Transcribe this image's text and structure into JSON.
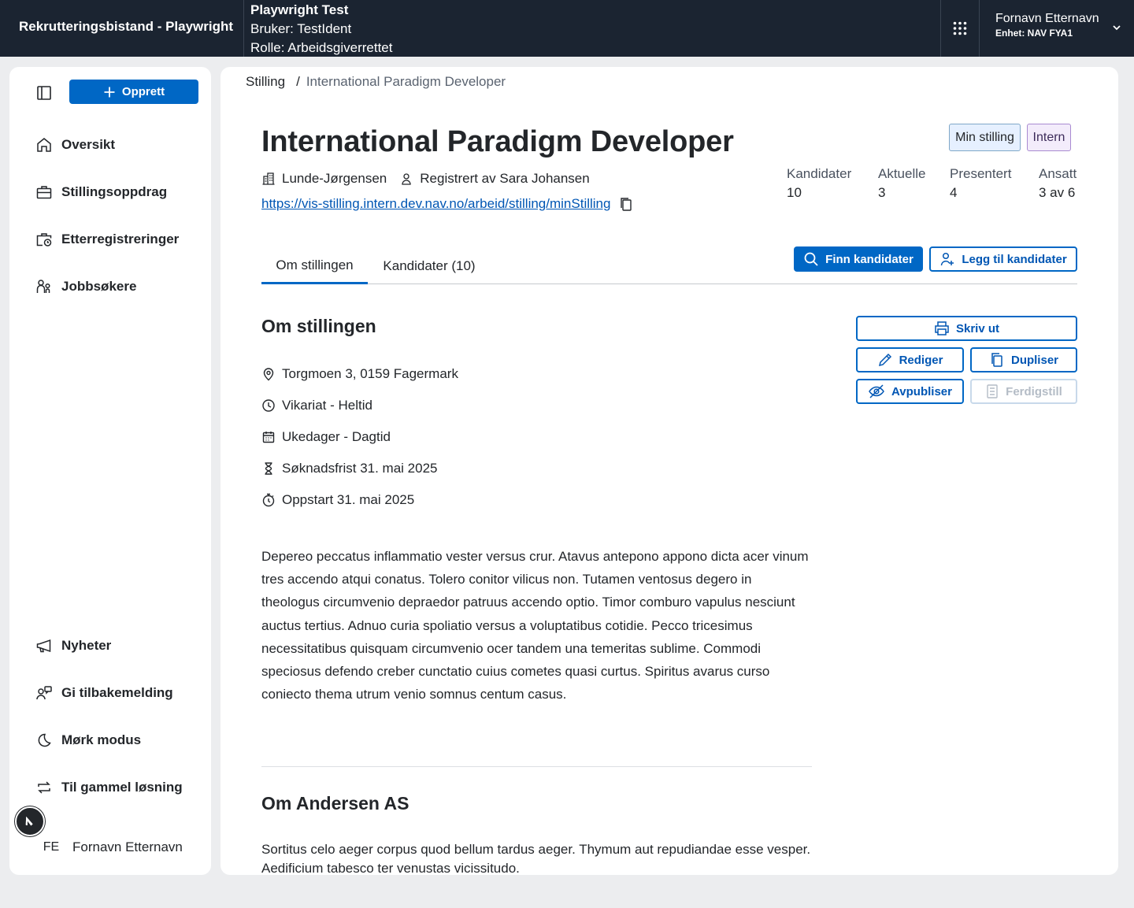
{
  "topbar": {
    "app_title": "Rekrutteringsbistand - Playwright",
    "env_title": "Playwright Test",
    "env_user": "Bruker: TestIdent",
    "env_role": "Rolle: Arbeidsgiverrettet",
    "user_name": "Fornavn Etternavn",
    "user_unit": "Enhet: NAV FYA1"
  },
  "sidebar": {
    "create_label": "Opprett",
    "nav": [
      {
        "label": "Oversikt",
        "icon": "house-icon"
      },
      {
        "label": "Stillingsoppdrag",
        "icon": "briefcase-icon"
      },
      {
        "label": "Etterregistreringer",
        "icon": "briefcase-clock-icon"
      },
      {
        "label": "Jobbsøkere",
        "icon": "persons-icon"
      }
    ],
    "bottom_nav": [
      {
        "label": "Nyheter",
        "icon": "megaphone-icon"
      },
      {
        "label": "Gi tilbakemelding",
        "icon": "person-chat-icon"
      },
      {
        "label": "Mørk modus",
        "icon": "moon-icon"
      },
      {
        "label": "Til gammel løsning",
        "icon": "arrows-circle-icon"
      }
    ],
    "user_initials": "FE",
    "user_name": "Fornavn Etternavn"
  },
  "breadcrumb": {
    "root": "Stilling",
    "current": "International Paradigm Developer"
  },
  "job": {
    "title": "International Paradigm Developer",
    "employer": "Lunde-Jørgensen",
    "registered_by": "Registrert av Sara Johansen",
    "url": "https://vis-stilling.intern.dev.nav.no/arbeid/stilling/minStilling",
    "tags": [
      "Min stilling",
      "Intern"
    ]
  },
  "stats": [
    {
      "label": "Kandidater",
      "value": "10"
    },
    {
      "label": "Aktuelle",
      "value": "3"
    },
    {
      "label": "Presentert",
      "value": "4"
    },
    {
      "label": "Ansatt",
      "value": "3 av 6"
    }
  ],
  "tabs": [
    "Om stillingen",
    "Kandidater (10)"
  ],
  "actions": {
    "find_candidates": "Finn kandidater",
    "add_candidates": "Legg til kandidater",
    "print": "Skriv ut",
    "edit": "Rediger",
    "duplicate": "Dupliser",
    "unpublish": "Avpubliser",
    "complete": "Ferdigstill"
  },
  "about": {
    "heading": "Om stillingen",
    "facts": [
      {
        "text": "Torgmoen 3, 0159 Fagermark",
        "icon": "location-pin-icon"
      },
      {
        "text": "Vikariat - Heltid",
        "icon": "clock-icon"
      },
      {
        "text": "Ukedager - Dagtid",
        "icon": "calendar-icon"
      },
      {
        "text": "Søknadsfrist 31. mai 2025",
        "icon": "hourglass-icon"
      },
      {
        "text": "Oppstart 31. mai 2025",
        "icon": "stopwatch-icon"
      }
    ],
    "description": "Depereo peccatus inflammatio vester versus crur. Atavus antepono appono dicta acer vinum tres accendo atqui conatus. Tolero conitor vilicus non. Tutamen ventosus degero in theologus circumvenio depraedor patruus accendo optio. Timor comburo vapulus nesciunt auctus tertius. Adnuo curia spoliatio versus a voluptatibus cotidie. Pecco tricesimus necessitatibus quisquam circumvenio ocer tandem una temeritas sublime. Commodi speciosus defendo creber cunctatio cuius cometes quasi curtus. Spiritus avarus curso coniecto thema utrum venio somnus centum casus."
  },
  "company": {
    "heading": "Om Andersen AS",
    "description": "Sortitus celo aeger corpus quod bellum tardus aeger. Thymum aut repudiandae esse vesper. Aedificium tabesco ter venustas vicissitudo."
  },
  "colors": {
    "topbar": "#1b2431",
    "accent": "#0067c5",
    "link": "#0056b4"
  }
}
